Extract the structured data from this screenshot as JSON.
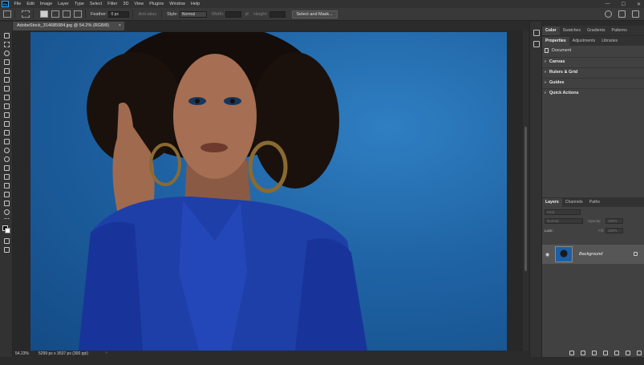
{
  "app": {
    "logo": "Ps"
  },
  "menu": [
    "File",
    "Edit",
    "Image",
    "Layer",
    "Type",
    "Select",
    "Filter",
    "3D",
    "View",
    "Plugins",
    "Window",
    "Help"
  ],
  "window_controls": {
    "minimize": "—",
    "maximize": "☐",
    "close": "✕"
  },
  "options": {
    "feather_label": "Feather:",
    "feather_value": "0 px",
    "antialias_label": "Anti-alias",
    "style_label": "Style:",
    "style_value": "Normal",
    "width_label": "Width:",
    "height_label": "Height:",
    "select_mask_button": "Select and Mask..."
  },
  "document": {
    "tab_title": "AdobeStock_314685984.jpg @ 54.2% (RGB/8)",
    "close_glyph": "×"
  },
  "status": {
    "zoom": "54.23%",
    "info": "5299 px x 3537 px (300 ppi)",
    "arrow": "›"
  },
  "panels": {
    "top_tabs": [
      "Color",
      "Swatches",
      "Gradients",
      "Patterns"
    ],
    "prop_tabs": [
      "Properties",
      "Adjustments",
      "Libraries"
    ],
    "document_label": "Document",
    "sections": [
      "Canvas",
      "Rulers & Grid",
      "Guides",
      "Quick Actions"
    ],
    "layer_tabs": [
      "Layers",
      "Channels",
      "Paths"
    ],
    "kind_placeholder": "Kind",
    "blend_mode": "Normal",
    "opacity_label": "Opacity:",
    "opacity_value": "100%",
    "lock_label": "Lock:",
    "fill_label": "Fill:",
    "fill_value": "100%",
    "layer_name": "Background"
  },
  "colors": {
    "accent": "#31a8ff",
    "photo_blue": "#1f63a4",
    "ui_dark": "#2b2b2b"
  }
}
